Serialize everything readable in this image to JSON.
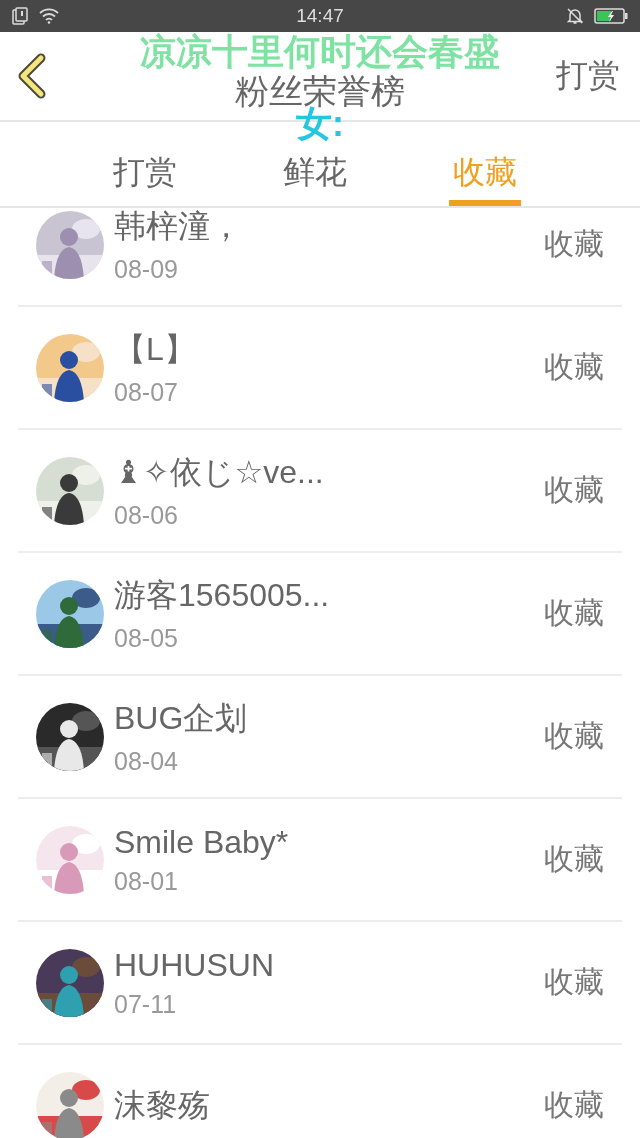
{
  "status_bar": {
    "time": "14:47"
  },
  "header": {
    "title": "粉丝荣誉榜",
    "action": "打赏"
  },
  "overlay": [
    {
      "text": "凉凉十里何时还会春盛",
      "color": "#7ee3a2"
    },
    {
      "text": "女:",
      "color": "#25c6e0"
    }
  ],
  "tabs": [
    {
      "label": "打赏",
      "selected": false
    },
    {
      "label": "鲜花",
      "selected": false
    },
    {
      "label": "收藏",
      "selected": true
    }
  ],
  "rows": [
    {
      "name": "韩梓潼，",
      "date": "08-09",
      "action": "收藏"
    },
    {
      "name": "【L】",
      "date": "08-07",
      "action": "收藏"
    },
    {
      "name": "♝✧依じ☆ve...",
      "date": "08-06",
      "action": "收藏"
    },
    {
      "name": "游客1565005...",
      "date": "08-05",
      "action": "收藏"
    },
    {
      "name": "BUG企划",
      "date": "08-04",
      "action": "收藏"
    },
    {
      "name": "Smile Baby*",
      "date": "08-01",
      "action": "收藏"
    },
    {
      "name": "HUHUSUN",
      "date": "07-11",
      "action": "收藏"
    },
    {
      "name": "沫黎殇",
      "action": "收藏"
    }
  ]
}
